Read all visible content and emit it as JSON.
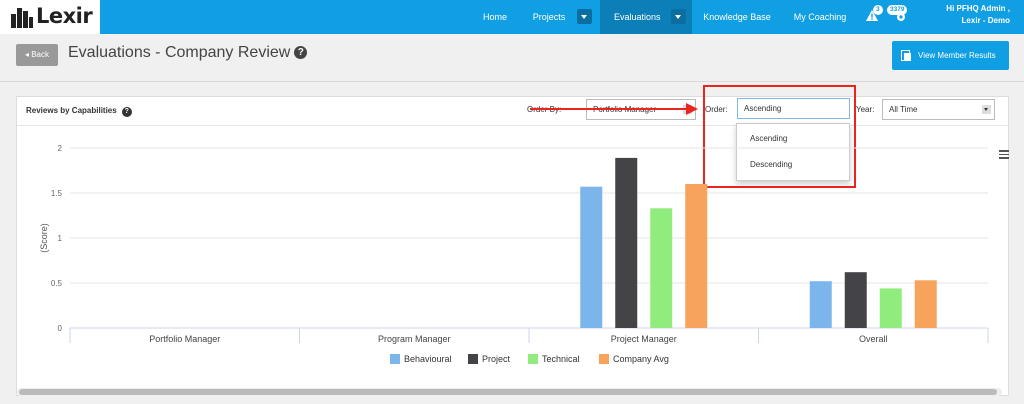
{
  "app": {
    "logo_text": "Lexir"
  },
  "nav": {
    "items": [
      {
        "label": "Home"
      },
      {
        "label": "Projects"
      },
      {
        "label": "Evaluations"
      },
      {
        "label": "Knowledge Base"
      },
      {
        "label": "My Coaching"
      }
    ],
    "notifications": {
      "warning_count": "3",
      "message_count": "3379"
    },
    "user": {
      "greeting": "Hi PFHQ Admin ,",
      "org": "Lexir - Demo"
    }
  },
  "header": {
    "back_label": "Back",
    "title": "Evaluations - Company Review",
    "view_member_results_label": "View Member Results"
  },
  "panel": {
    "title": "Reviews by Capabilities",
    "order_by_label": "Order By:",
    "order_by_value": "Portfolio Manager",
    "order_label": "Order:",
    "order_value": "Ascending",
    "year_label": "Year:",
    "year_value": "All Time",
    "order_options": [
      "Ascending",
      "Descending"
    ]
  },
  "colors": {
    "accent": "#119fe4",
    "annotation": "#e8251f"
  },
  "chart_data": {
    "type": "bar",
    "ylabel": "(Score)",
    "xlabel": "",
    "ylim": [
      0,
      2
    ],
    "yticks": [
      "0",
      "0.5",
      "1",
      "1.5",
      "2"
    ],
    "categories": [
      "Portfolio Manager",
      "Program Manager",
      "Project Manager",
      "Overall"
    ],
    "series": [
      {
        "name": "Behavioural",
        "color": "#7cb5ec",
        "values": [
          null,
          null,
          1.57,
          0.52
        ]
      },
      {
        "name": "Project",
        "color": "#434348",
        "values": [
          null,
          null,
          1.89,
          0.62
        ]
      },
      {
        "name": "Technical",
        "color": "#90ed7d",
        "values": [
          null,
          null,
          1.33,
          0.44
        ]
      },
      {
        "name": "Company Avg",
        "color": "#f7a35c",
        "values": [
          null,
          null,
          1.6,
          0.53
        ]
      }
    ],
    "grid": true,
    "legend": "bottom"
  }
}
